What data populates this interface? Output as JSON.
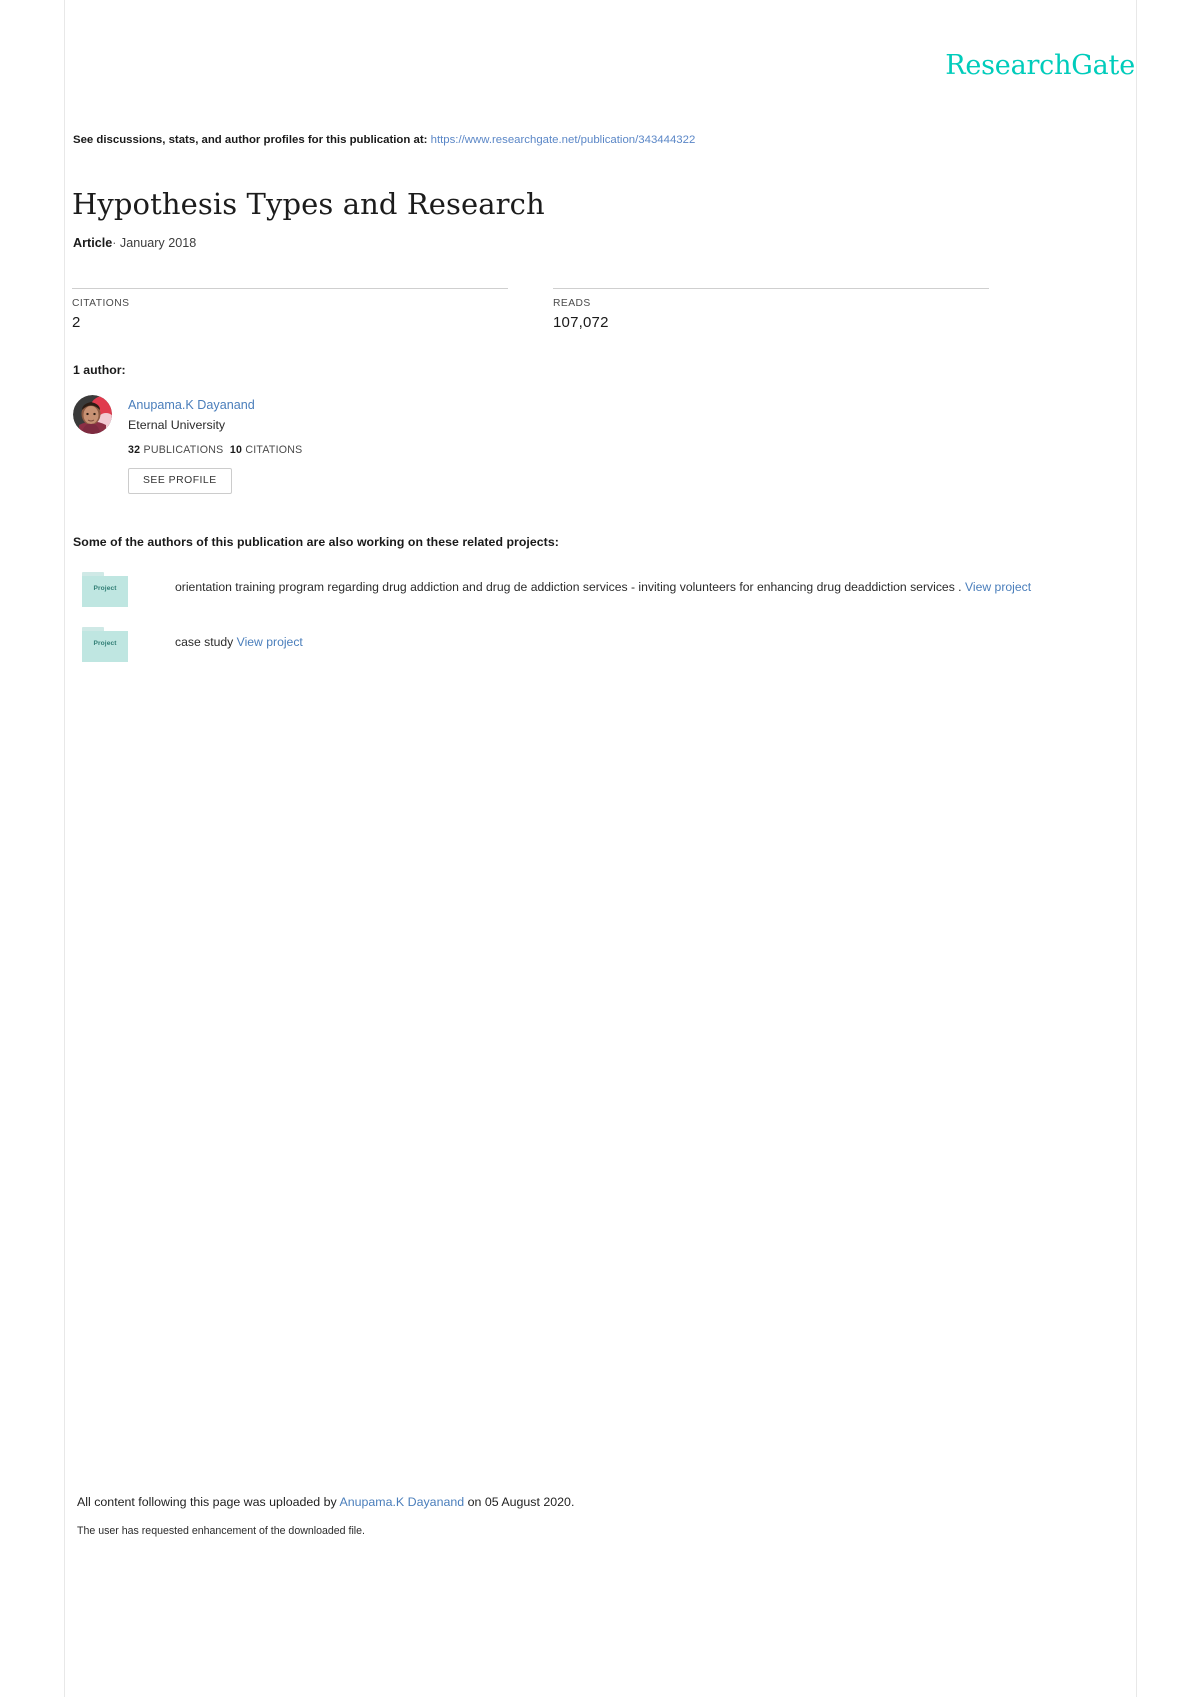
{
  "brand": {
    "logo_text": "ResearchGate",
    "logo_color": "#00CCBB",
    "link_color": "#4a7ebb"
  },
  "disclosure": {
    "prefix": "See discussions, stats, and author profiles for this publication at:",
    "url": "https://www.researchgate.net/publication/343444322"
  },
  "publication": {
    "title": "Hypothesis Types and Research",
    "type": "Article",
    "separator": "·",
    "date": "January 2018"
  },
  "stats": [
    {
      "label": "CITATIONS",
      "value": "2"
    },
    {
      "label": "READS",
      "value": "107,072"
    }
  ],
  "authors": {
    "heading": "1 author:",
    "list": [
      {
        "name": "Anupama.K Dayanand",
        "affiliation": "Eternal University",
        "publications_count": "32",
        "publications_label": "PUBLICATIONS",
        "citations_count": "10",
        "citations_label": "CITATIONS",
        "profile_button": "SEE PROFILE",
        "avatar_name": "author-avatar-photo"
      }
    ]
  },
  "projects": {
    "heading": "Some of the authors of this publication are also working on these related projects:",
    "icon_label": "Project",
    "items": [
      {
        "description": "orientation training program regarding drug addiction and drug de addiction services - inviting volunteers for enhancing drug deaddiction services .",
        "link_text": "View project"
      },
      {
        "description": "case study",
        "link_text": "View project"
      }
    ]
  },
  "footer": {
    "upload_prefix": "All content following this page was uploaded by",
    "uploader": "Anupama.K Dayanand",
    "upload_suffix": "on 05 August 2020.",
    "note": "The user has requested enhancement of the downloaded file."
  }
}
